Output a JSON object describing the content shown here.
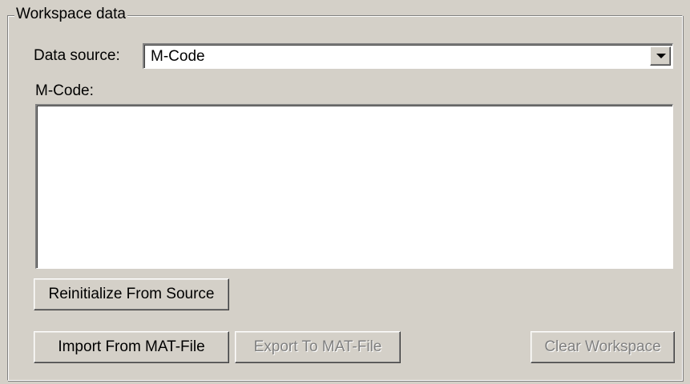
{
  "group": {
    "title": "Workspace data"
  },
  "data_source": {
    "label": "Data source:",
    "selected": "M-Code"
  },
  "mcode": {
    "label": "M-Code:",
    "value": ""
  },
  "buttons": {
    "reinitialize": "Reinitialize From Source",
    "import": "Import From MAT-File",
    "export": "Export To MAT-File",
    "clear": "Clear Workspace"
  }
}
